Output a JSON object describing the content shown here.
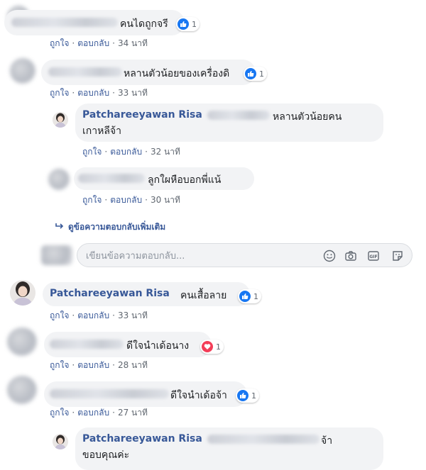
{
  "comments": [
    {
      "text": "คนไดถูกจรี",
      "reaction_count": "1",
      "actions": {
        "like": "ถูกใจ",
        "reply": "ตอบกลับ",
        "time": "34 นาที"
      }
    },
    {
      "text": "หลานตัวน้อยของเครื่องดิ",
      "reaction_count": "1",
      "actions": {
        "like": "ถูกใจ",
        "reply": "ตอบกลับ",
        "time": "33 นาที"
      }
    },
    {
      "name": "Patchareeyawan Risa",
      "text_line1": "หลานตัวน้อยคน",
      "text_line2": "เกาหลีจ้า",
      "actions": {
        "like": "ถูกใจ",
        "reply": "ตอบกลับ",
        "time": "32 นาที"
      }
    },
    {
      "text": "ลูกใผหือบอกพี่แน้",
      "actions": {
        "like": "ถูกใจ",
        "reply": "ตอบกลับ",
        "time": "30 นาที"
      }
    },
    {
      "name": "Patchareeyawan Risa",
      "text": "คนเสื้อลาย",
      "reaction_count": "1",
      "actions": {
        "like": "ถูกใจ",
        "reply": "ตอบกลับ",
        "time": "33 นาที"
      }
    },
    {
      "text": "ดีใจนำเด้อนาง",
      "reaction_count": "1",
      "actions": {
        "like": "ถูกใจ",
        "reply": "ตอบกลับ",
        "time": "28 นาที"
      }
    },
    {
      "text": "ดีใจนำเด้อจ้า",
      "reaction_count": "1",
      "actions": {
        "like": "ถูกใจ",
        "reply": "ตอบกลับ",
        "time": "27 นาที"
      }
    },
    {
      "name": "Patchareeyawan Risa",
      "text_line1": "จ้า",
      "text_line2": "ขอบคุณค่ะ"
    }
  ],
  "more_replies": "ดูข้อความตอบกลับเพิ่มเติม",
  "reply_placeholder": "เขียนข้อความตอบกลับ...",
  "colors": {
    "link": "#385898",
    "like": "#1877f2",
    "love": "#f33e58",
    "bubble": "#f2f3f5"
  },
  "icons": [
    "like-icon",
    "love-icon",
    "reply-arrow-icon",
    "emoji-icon",
    "camera-icon",
    "gif-icon",
    "sticker-icon"
  ]
}
